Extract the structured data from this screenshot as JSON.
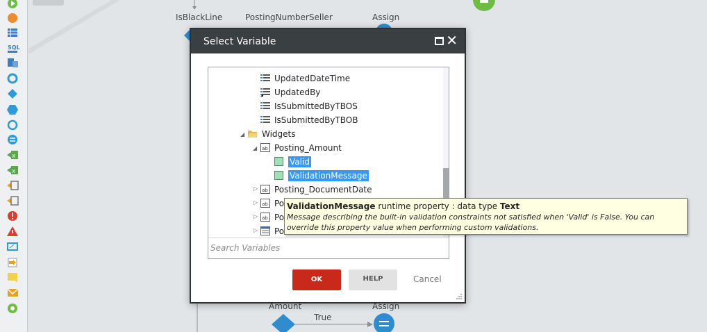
{
  "toolbox": {
    "tools": [
      {
        "icon": "start-icon",
        "color": "#6dbd45"
      },
      {
        "icon": "end-icon",
        "color": "#f08a2c"
      },
      {
        "icon": "list-icon",
        "color": "#3b7dc4"
      },
      {
        "icon": "sql-icon",
        "color": "#3b7dc4",
        "text": "SQL"
      },
      {
        "icon": "aggregate-icon",
        "color": "#3b7dc4"
      },
      {
        "icon": "foreach-icon",
        "color": "#2e9bd6"
      },
      {
        "icon": "if-icon",
        "color": "#2e9bd6"
      },
      {
        "icon": "switch-icon",
        "color": "#2e9bd6"
      },
      {
        "icon": "loop-icon",
        "color": "#2e9bd6"
      },
      {
        "icon": "assign-icon",
        "color": "#2e9bd6"
      },
      {
        "icon": "record-list-append-icon",
        "color": "#5aa84a"
      },
      {
        "icon": "record-list-insert-icon",
        "color": "#5aa84a"
      },
      {
        "icon": "execute-action-icon",
        "color": "#777"
      },
      {
        "icon": "exception-icon",
        "color": "#777"
      },
      {
        "icon": "raise-error-icon",
        "color": "#e03b2f"
      },
      {
        "icon": "warning-icon",
        "color": "#e03b2f"
      },
      {
        "icon": "screen-icon",
        "color": "#2e9bd6"
      },
      {
        "icon": "download-icon",
        "color": "#e5a323"
      },
      {
        "icon": "comment-icon",
        "color": "#e5c323"
      },
      {
        "icon": "email-icon",
        "color": "#e5a323"
      },
      {
        "icon": "end-node-icon",
        "color": "#6dbd45"
      }
    ]
  },
  "canvas": {
    "labels": {
      "isblackline": "IsBlackLine",
      "postingnumberseller": "PostingNumberSeller",
      "assign_top": "Assign",
      "amount": "Amount",
      "true_bottom": "True",
      "assign_bottom": "Assign"
    }
  },
  "dialog": {
    "title": "Select Variable",
    "tree": [
      {
        "label": "UpdatedDateTime",
        "icon": "attribute-icon"
      },
      {
        "label": "UpdatedBy",
        "icon": "foreign-key-icon"
      },
      {
        "label": "IsSubmittedByTBOS",
        "icon": "attribute-icon"
      },
      {
        "label": "IsSubmittedByTBOB",
        "icon": "attribute-icon"
      },
      {
        "label": "Widgets",
        "icon": "folder-icon",
        "expanded": true
      },
      {
        "label": "Posting_Amount",
        "icon": "input-widget-icon",
        "expanded": true
      },
      {
        "label": "Valid",
        "icon": "runtime-property-icon",
        "selected": true
      },
      {
        "label": "ValidationMessage",
        "icon": "runtime-property-icon",
        "selected": true
      },
      {
        "label": "Posting_DocumentDate",
        "icon": "input-widget-icon",
        "expanded": false
      },
      {
        "label": "Po",
        "icon": "input-widget-icon",
        "expanded": false
      },
      {
        "label": "Po",
        "icon": "input-widget-icon",
        "expanded": false
      },
      {
        "label": "Po",
        "icon": "table-widget-icon",
        "expanded": false
      }
    ],
    "search_placeholder": "Search Variables",
    "ok_label": "OK",
    "help_label": "HELP",
    "cancel_label": "Cancel"
  },
  "tooltip": {
    "name": "ValidationMessage",
    "kind": "runtime property : data type",
    "type": "Text",
    "description": "Message describing the built-in validation constraints not satisfied when 'Valid' is False. You can override this property value when performing custom validations."
  }
}
